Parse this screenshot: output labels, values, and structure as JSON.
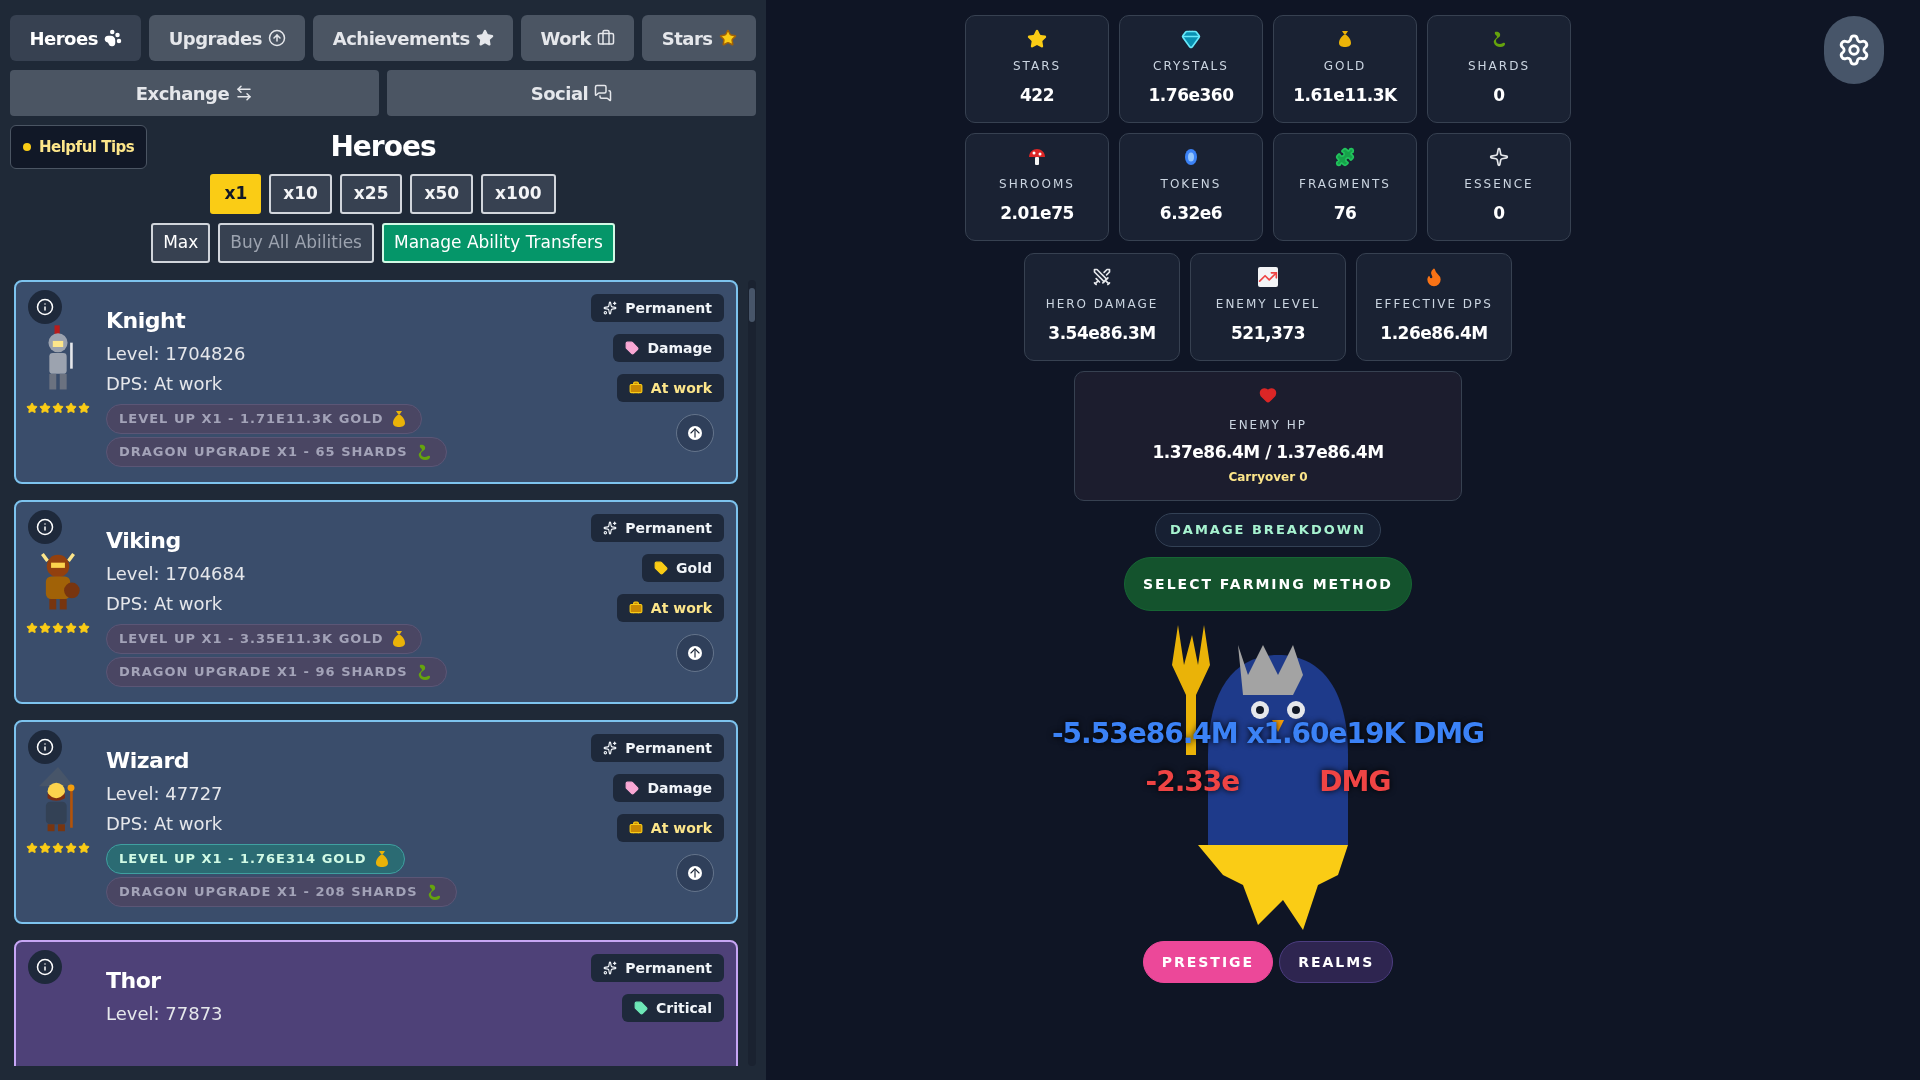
{
  "tabs": [
    {
      "label": "Heroes",
      "selected": true
    },
    {
      "label": "Upgrades",
      "selected": false
    },
    {
      "label": "Achievements",
      "selected": false
    },
    {
      "label": "Work",
      "selected": false
    },
    {
      "label": "Stars",
      "selected": false
    }
  ],
  "tabs_row2": [
    {
      "label": "Exchange",
      "selected": false
    },
    {
      "label": "Social",
      "selected": false
    }
  ],
  "tips_button": {
    "label": "Helpful Tips"
  },
  "title": "Heroes",
  "multipliers": [
    {
      "label": "x1",
      "selected": true
    },
    {
      "label": "x10",
      "selected": false
    },
    {
      "label": "x25",
      "selected": false
    },
    {
      "label": "x50",
      "selected": false
    },
    {
      "label": "x100",
      "selected": false
    }
  ],
  "actions": [
    {
      "label": "Max",
      "kind": "outline",
      "disabled": false
    },
    {
      "label": "Buy All Abilities",
      "kind": "outline",
      "disabled": true
    },
    {
      "label": "Manage Ability Transfers",
      "kind": "primary",
      "disabled": false
    }
  ],
  "heroes": [
    {
      "name": "Knight",
      "color": "#7dc3ee",
      "level": "Level: 1704826",
      "dps": "DPS: At work",
      "stars": 5,
      "badges": [
        {
          "label": "Permanent",
          "kind": "permanent"
        },
        {
          "label": "Damage",
          "kind": "tag",
          "color": "#f9a8d4"
        },
        {
          "label": "At work",
          "kind": "work"
        }
      ],
      "level_up": {
        "label": "LEVEL UP X1 - 1.71E11.3K GOLD",
        "affordable": false
      },
      "dragon_upgrade": {
        "label": "DRAGON UPGRADE X1 - 65 SHARDS"
      }
    },
    {
      "name": "Viking",
      "color": "#7dc3ee",
      "level": "Level: 1704684",
      "dps": "DPS: At work",
      "stars": 5,
      "badges": [
        {
          "label": "Permanent",
          "kind": "permanent"
        },
        {
          "label": "Gold",
          "kind": "tag",
          "color": "#facc15"
        },
        {
          "label": "At work",
          "kind": "work"
        }
      ],
      "level_up": {
        "label": "LEVEL UP X1 - 3.35E11.3K GOLD",
        "affordable": false
      },
      "dragon_upgrade": {
        "label": "DRAGON UPGRADE X1 - 96 SHARDS"
      }
    },
    {
      "name": "Wizard",
      "color": "#7dc3ee",
      "level": "Level: 47727",
      "dps": "DPS: At work",
      "stars": 5,
      "badges": [
        {
          "label": "Permanent",
          "kind": "permanent"
        },
        {
          "label": "Damage",
          "kind": "tag",
          "color": "#f9a8d4"
        },
        {
          "label": "At work",
          "kind": "work"
        }
      ],
      "level_up": {
        "label": "LEVEL UP X1 - 1.76E314 GOLD",
        "affordable": true
      },
      "dragon_upgrade": {
        "label": "DRAGON UPGRADE X1 - 208 SHARDS"
      }
    },
    {
      "name": "Thor",
      "color": "#c7a6f5",
      "level": "Level: 77873",
      "badges": [
        {
          "label": "Permanent",
          "kind": "permanent"
        },
        {
          "label": "Critical",
          "kind": "tag",
          "color": "#6ee7b7"
        }
      ]
    }
  ],
  "stats": [
    {
      "label": "STARS",
      "value": "422"
    },
    {
      "label": "CRYSTALS",
      "value": "1.76e360"
    },
    {
      "label": "GOLD",
      "value": "1.61e11.3K"
    },
    {
      "label": "SHARDS",
      "value": "0"
    },
    {
      "label": "SHROOMS",
      "value": "2.01e75"
    },
    {
      "label": "TOKENS",
      "value": "6.32e6"
    },
    {
      "label": "FRAGMENTS",
      "value": "76"
    },
    {
      "label": "ESSENCE",
      "value": "0"
    }
  ],
  "combat_stats": [
    {
      "label": "HERO DAMAGE",
      "value": "3.54e86.3M"
    },
    {
      "label": "ENEMY LEVEL",
      "value": "521,373"
    },
    {
      "label": "EFFECTIVE DPS",
      "value": "1.26e86.4M"
    }
  ],
  "enemy_hp": {
    "label": "ENEMY HP",
    "value": "1.37e86.4M / 1.37e86.4M",
    "carryover": "Carryover 0"
  },
  "damage_breakdown_button": "DAMAGE BREAKDOWN",
  "farming_button": "SELECT FARMING METHOD",
  "floating_damage": [
    {
      "kind": "hit",
      "parts": [
        "-5.53e86.4M x1.60e19K DMG"
      ]
    },
    {
      "kind": "crit",
      "parts": [
        "-2.33e",
        "DMG"
      ]
    }
  ],
  "bottom_buttons": [
    {
      "label": "PRESTIGE",
      "kind": "prestige"
    },
    {
      "label": "REALMS",
      "kind": "realms"
    }
  ]
}
